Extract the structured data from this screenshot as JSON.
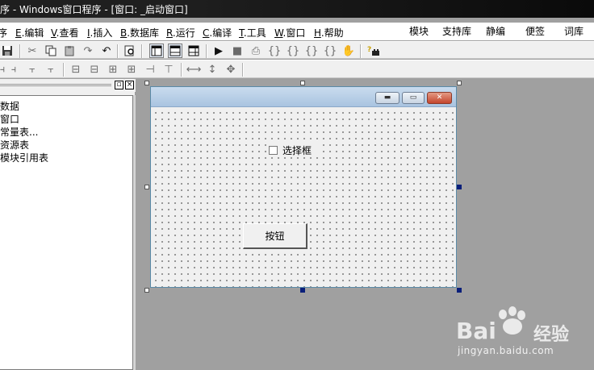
{
  "window": {
    "title": "序 - Windows窗口程序 - [窗口: _启动窗口]"
  },
  "menu": {
    "items": [
      {
        "label": "序"
      },
      {
        "key": "E",
        "label": ".编辑"
      },
      {
        "key": "V",
        "label": ".查看"
      },
      {
        "key": "I",
        "label": ".插入"
      },
      {
        "key": "B",
        "label": ".数据库"
      },
      {
        "key": "R",
        "label": ".运行"
      },
      {
        "key": "C",
        "label": ".编译"
      },
      {
        "key": "T",
        "label": ".工具"
      },
      {
        "key": "W",
        "label": ".窗口"
      },
      {
        "key": "H",
        "label": ".帮助"
      }
    ],
    "right_items": [
      "模块",
      "支持库",
      "静编",
      "便签",
      "词库"
    ]
  },
  "toolbar1": {
    "icons": [
      "save-icon",
      "cut-icon",
      "copy-icon",
      "paste-icon",
      "redo-icon",
      "undo-icon",
      "find-icon",
      "layout-1-icon",
      "layout-2-icon",
      "layout-3-icon",
      "run-icon",
      "stop-icon",
      "step-icon",
      "step-into-icon",
      "step-over-icon",
      "step-out-icon",
      "breakpoint-icon",
      "hand-icon",
      "help-icon"
    ]
  },
  "toolbar2": {
    "icons": [
      "align-left-icon",
      "align-right-icon",
      "align-top-icon",
      "align-bottom-icon",
      "center-h-icon",
      "center-v-icon",
      "space-h-icon",
      "space-v-icon",
      "same-width-icon",
      "same-height-icon",
      "same-size-icon"
    ]
  },
  "left_panel": {
    "items": [
      "数据",
      "窗口",
      "常量表...",
      "资源表",
      "模块引用表"
    ]
  },
  "form": {
    "checkbox_label": "选择框",
    "checkbox_checked": false,
    "button_label": "按钮"
  },
  "watermark": {
    "brand": "Bai",
    "brand_suffix": "经验",
    "url": "jingyan.baidu.com"
  },
  "colors": {
    "titlebar": "#1f1f1f",
    "workspace": "#a0a0a0",
    "caption_light": "#c9dcee",
    "handle_active": "#0a1f7a"
  }
}
